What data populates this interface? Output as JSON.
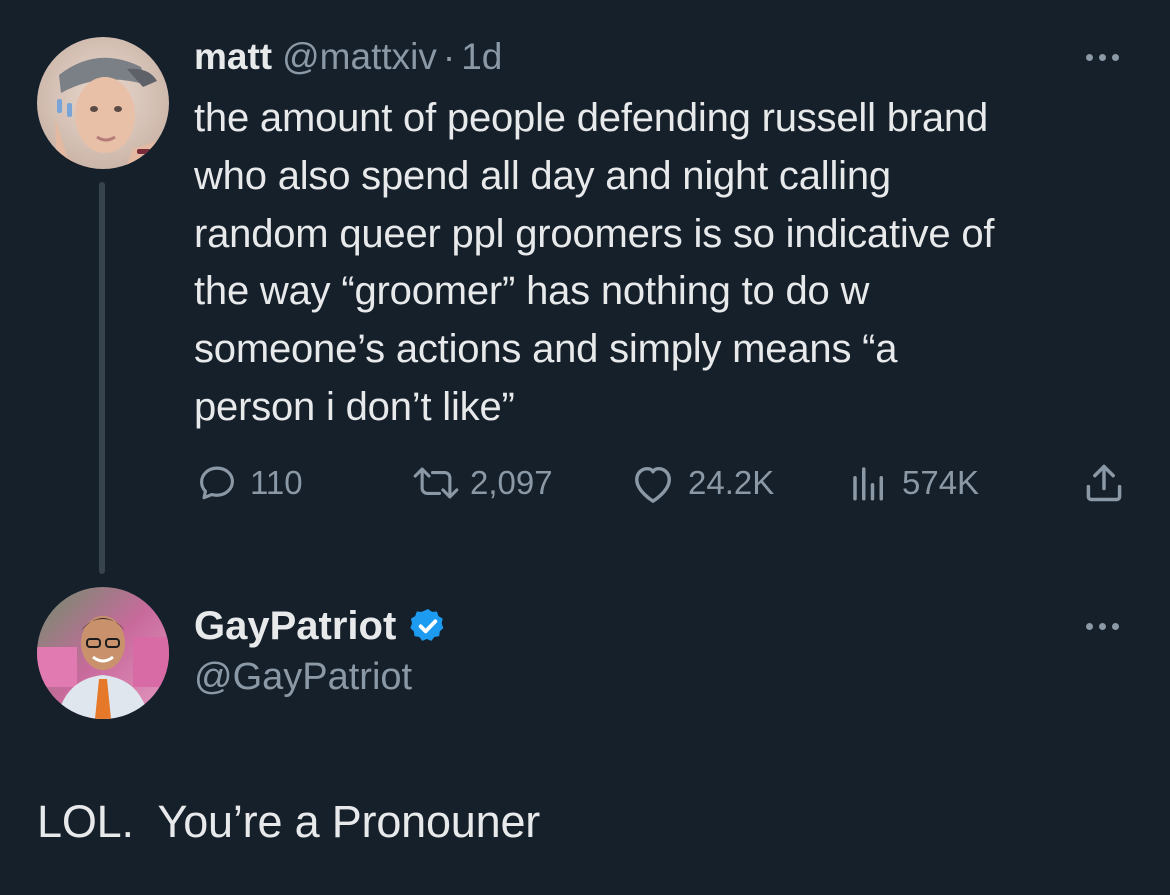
{
  "tweet": {
    "author_name": "matt",
    "handle": "@mattxiv",
    "separator": "·",
    "time": "1d",
    "text_lines": [
      "the amount of people defending russell brand",
      "who also spend all day and night calling",
      "random queer ppl groomers is so indicative of",
      "the way “groomer” has nothing to do w",
      "someone’s actions and simply means “a",
      "person i don’t like”"
    ],
    "stats": {
      "replies": "110",
      "retweets": "2,097",
      "likes": "24.2K",
      "views": "574K"
    }
  },
  "reply": {
    "author_name": "GayPatriot",
    "handle": "@GayPatriot",
    "verified": true,
    "text": "LOL.  You’re a Pronouner"
  },
  "icons": {
    "reply": "comment-bubble-icon",
    "retweet": "retweet-icon",
    "like": "heart-icon",
    "views": "bar-chart-icon",
    "share": "share-upload-icon",
    "more": "more-dots-icon",
    "verified": "verified-badge-icon"
  },
  "colors": {
    "background": "#15202b",
    "primary_text": "#e7e9ea",
    "secondary_text": "#8b98a5",
    "thread_line": "#38444d",
    "verified_blue": "#1d9bf0"
  }
}
